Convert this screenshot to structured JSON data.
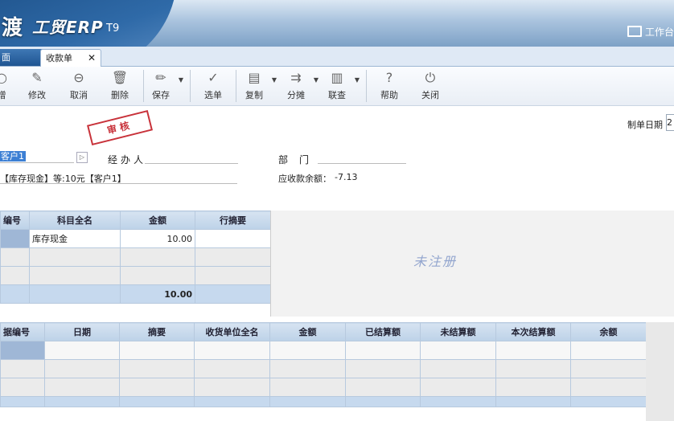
{
  "header": {
    "brand_logo": "渡",
    "product": "工贸ERP",
    "version": "T9",
    "workbench_label": "工作台"
  },
  "tabs": [
    {
      "label": "面"
    },
    {
      "label": "收款单",
      "close": "✕"
    }
  ],
  "toolbar": [
    {
      "label": "增",
      "icon": "○"
    },
    {
      "label": "修改",
      "icon": "✎"
    },
    {
      "label": "取消",
      "icon": "⊖"
    },
    {
      "label": "删除",
      "icon": "🗑"
    },
    {
      "label": "保存",
      "icon": "✏"
    },
    {
      "label": "选单",
      "icon": "✓"
    },
    {
      "label": "复制",
      "icon": "▤"
    },
    {
      "label": "分摊",
      "icon": "⇉"
    },
    {
      "label": "联查",
      "icon": "▥"
    },
    {
      "label": "帮助",
      "icon": "?"
    },
    {
      "label": "关闭",
      "icon": "⏻"
    }
  ],
  "form": {
    "stamp": "审核",
    "date_label": "制单日期",
    "date_value": "2",
    "customer": "客户1",
    "handler_label": "经办人",
    "dept_label": "部门",
    "summary": "【库存现金】等:10元【客户1】",
    "balance_label": "应收款余额：",
    "balance_value": "-7.13"
  },
  "upper_grid": {
    "columns": [
      "编号",
      "科目全名",
      "金额",
      "行摘要"
    ],
    "rows": [
      {
        "code": "",
        "account": "库存现金",
        "amount": "10.00",
        "memo": ""
      }
    ],
    "total": "10.00"
  },
  "watermark": "未注册",
  "lower_grid": {
    "columns": [
      "据编号",
      "日期",
      "摘要",
      "收货单位全名",
      "金额",
      "已结算额",
      "未结算额",
      "本次结算额",
      "余额"
    ]
  },
  "colors": {
    "header_dark": "#1c4f86",
    "grid_header": "#bdd2e8",
    "selection": "#3c7fd4",
    "stamp": "#c8323a"
  }
}
